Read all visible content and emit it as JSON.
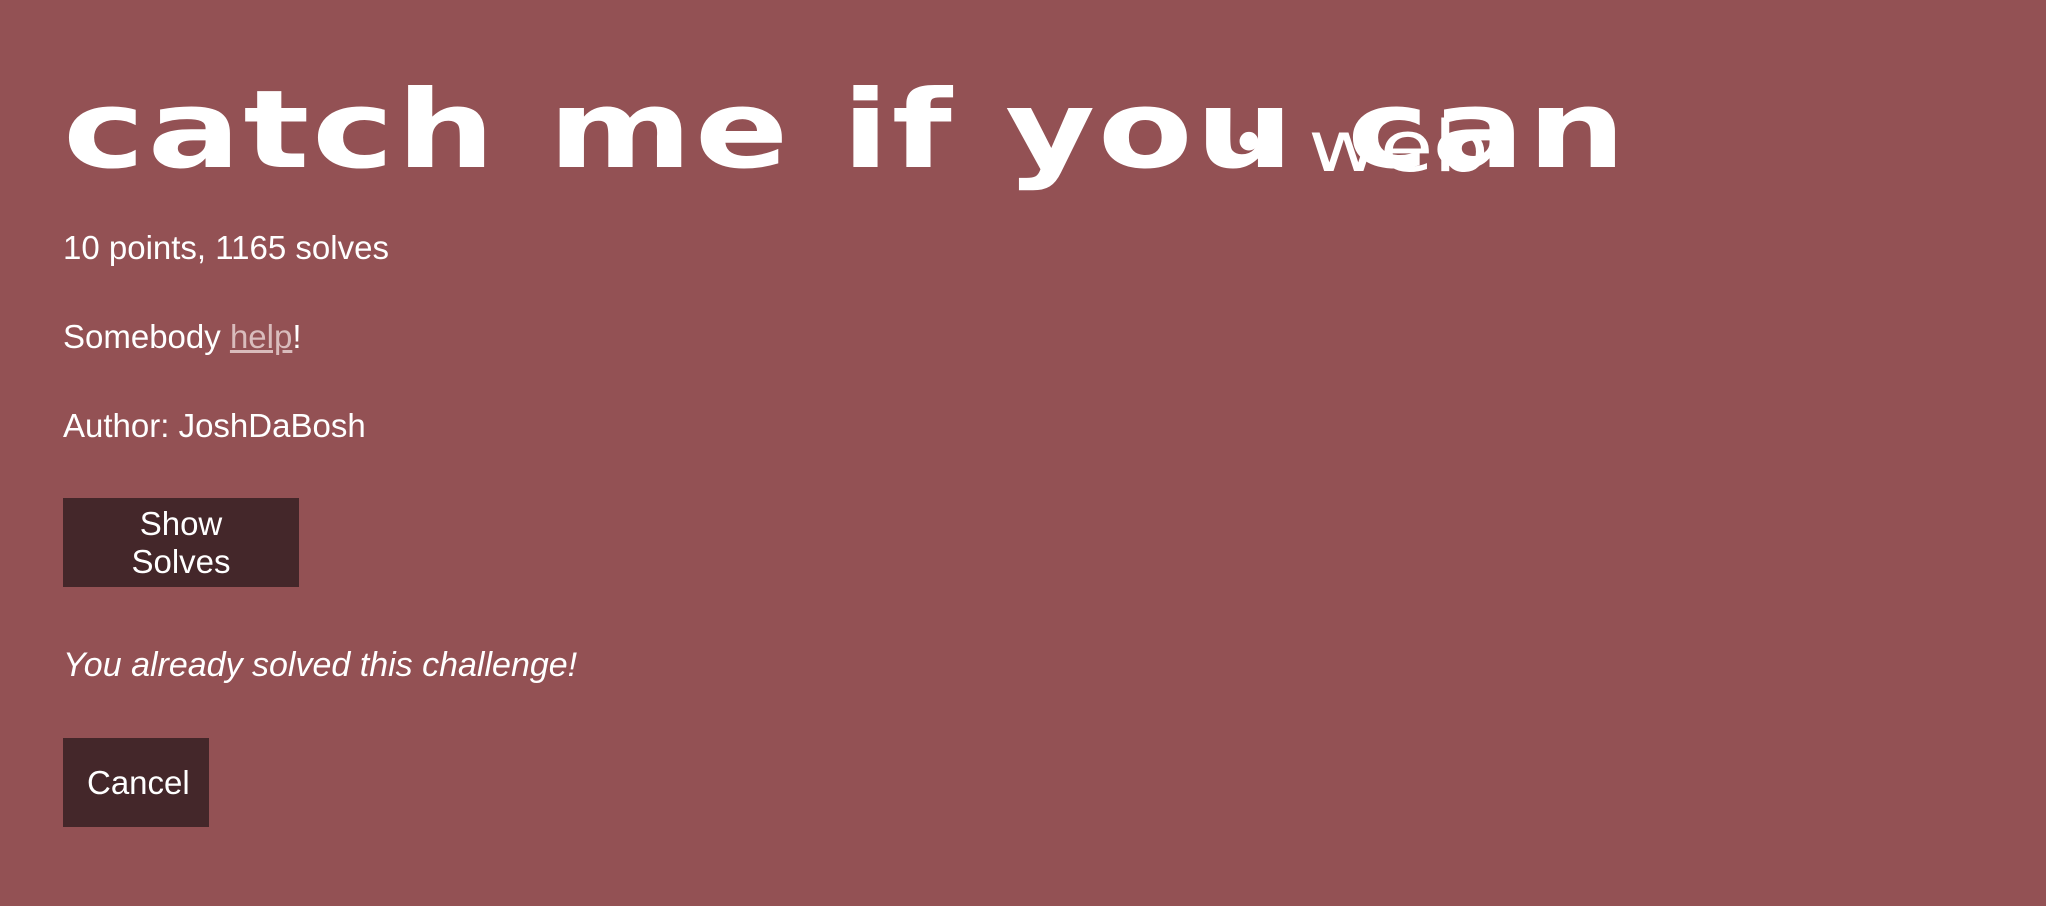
{
  "challenge": {
    "name": "catch me if you can",
    "separator": "•",
    "category": "web",
    "points_solves": "10 points, 1165 solves",
    "description_prefix": "Somebody ",
    "description_link": "help",
    "description_suffix": "!",
    "author": "Author: JoshDaBosh"
  },
  "actions": {
    "show_solves_label": "Show Solves",
    "cancel_label": "Cancel"
  },
  "status": {
    "solved_message": "You already solved this challenge!"
  },
  "colors": {
    "background": "#935154",
    "button_bg": "#44272a",
    "link": "#d9bcbc"
  }
}
